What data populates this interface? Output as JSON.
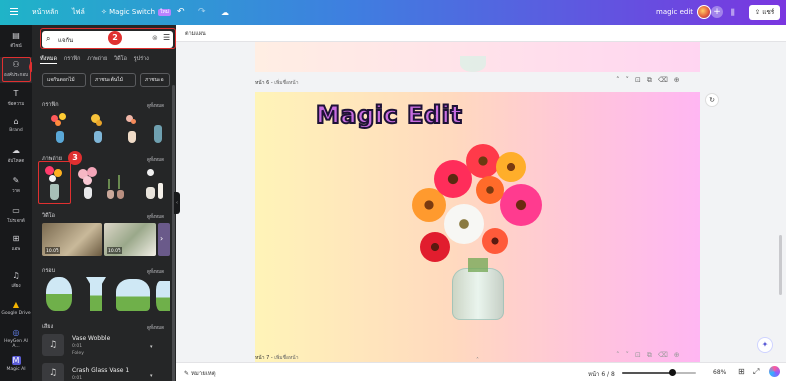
{
  "topbar": {
    "home": "หน้าหลัก",
    "file": "ไฟล์",
    "magic_switch": "Magic Switch",
    "magic_switch_badge": "ใหม่",
    "doc_title": "magic edit",
    "share": "แชร์"
  },
  "rail": {
    "items": [
      {
        "label": "ดีไซน์",
        "icon": "layout-icon"
      },
      {
        "label": "องค์ประกอบ",
        "icon": "elements-icon"
      },
      {
        "label": "ข้อความ",
        "icon": "text-icon"
      },
      {
        "label": "Brand",
        "icon": "brand-icon"
      },
      {
        "label": "อัปโหลด",
        "icon": "upload-icon"
      },
      {
        "label": "วาด",
        "icon": "draw-icon"
      },
      {
        "label": "โปรเจกต์",
        "icon": "folder-icon"
      },
      {
        "label": "แอพ",
        "icon": "apps-icon"
      },
      {
        "label": "เสียง",
        "icon": "audio-icon"
      },
      {
        "label": "Google Drive",
        "icon": "google-drive-icon"
      },
      {
        "label": "HeyGen AI A...",
        "icon": "heygen-icon"
      },
      {
        "label": "Magic AI",
        "icon": "magic-ai-icon"
      }
    ]
  },
  "callouts": {
    "one": "1",
    "two": "2",
    "three": "3"
  },
  "panel": {
    "search_value": "แจกัน",
    "tabs": [
      "ทั้งหมด",
      "กราฟิก",
      "ภาพถ่าย",
      "วิดีโอ",
      "รูปร่าง"
    ],
    "chips": [
      "แจกันดอกไม้",
      "ภาชนะต้นไม้",
      "ภาชนะอ"
    ],
    "sections": {
      "graphics": "กราฟิก",
      "photos": "ภาพถ่าย",
      "videos": "วิดีโอ",
      "frames": "กรอบ",
      "audio": "เสียง"
    },
    "see_all": "ดูทั้งหมด",
    "video_durations": [
      "10.0วิ",
      "10.0วิ"
    ],
    "audio_items": [
      {
        "title": "Vase Wobble",
        "duration": "0:01",
        "artist": "Foley"
      },
      {
        "title": "Crash Glass Vase 1",
        "duration": "0:01"
      }
    ]
  },
  "canvas": {
    "header_label": "ตามแผน",
    "page6_label": "หน้า 6 - ",
    "page6_placeholder": "เพิ่มชื่อหน้า",
    "page7_label": "หน้า 7 - ",
    "page7_placeholder": "เพิ่มชื่อหน้า",
    "magic_text": "Magic Edit"
  },
  "bottombar": {
    "notes": "หมายเหตุ",
    "page_indicator": "หน้า 6 / 8",
    "zoom": "68%",
    "zoom_level": 0.68
  },
  "colors": {
    "accent": "#7a36e0",
    "highlight": "#e03030",
    "panel_bg": "#252627",
    "rail_bg": "#18191b"
  }
}
